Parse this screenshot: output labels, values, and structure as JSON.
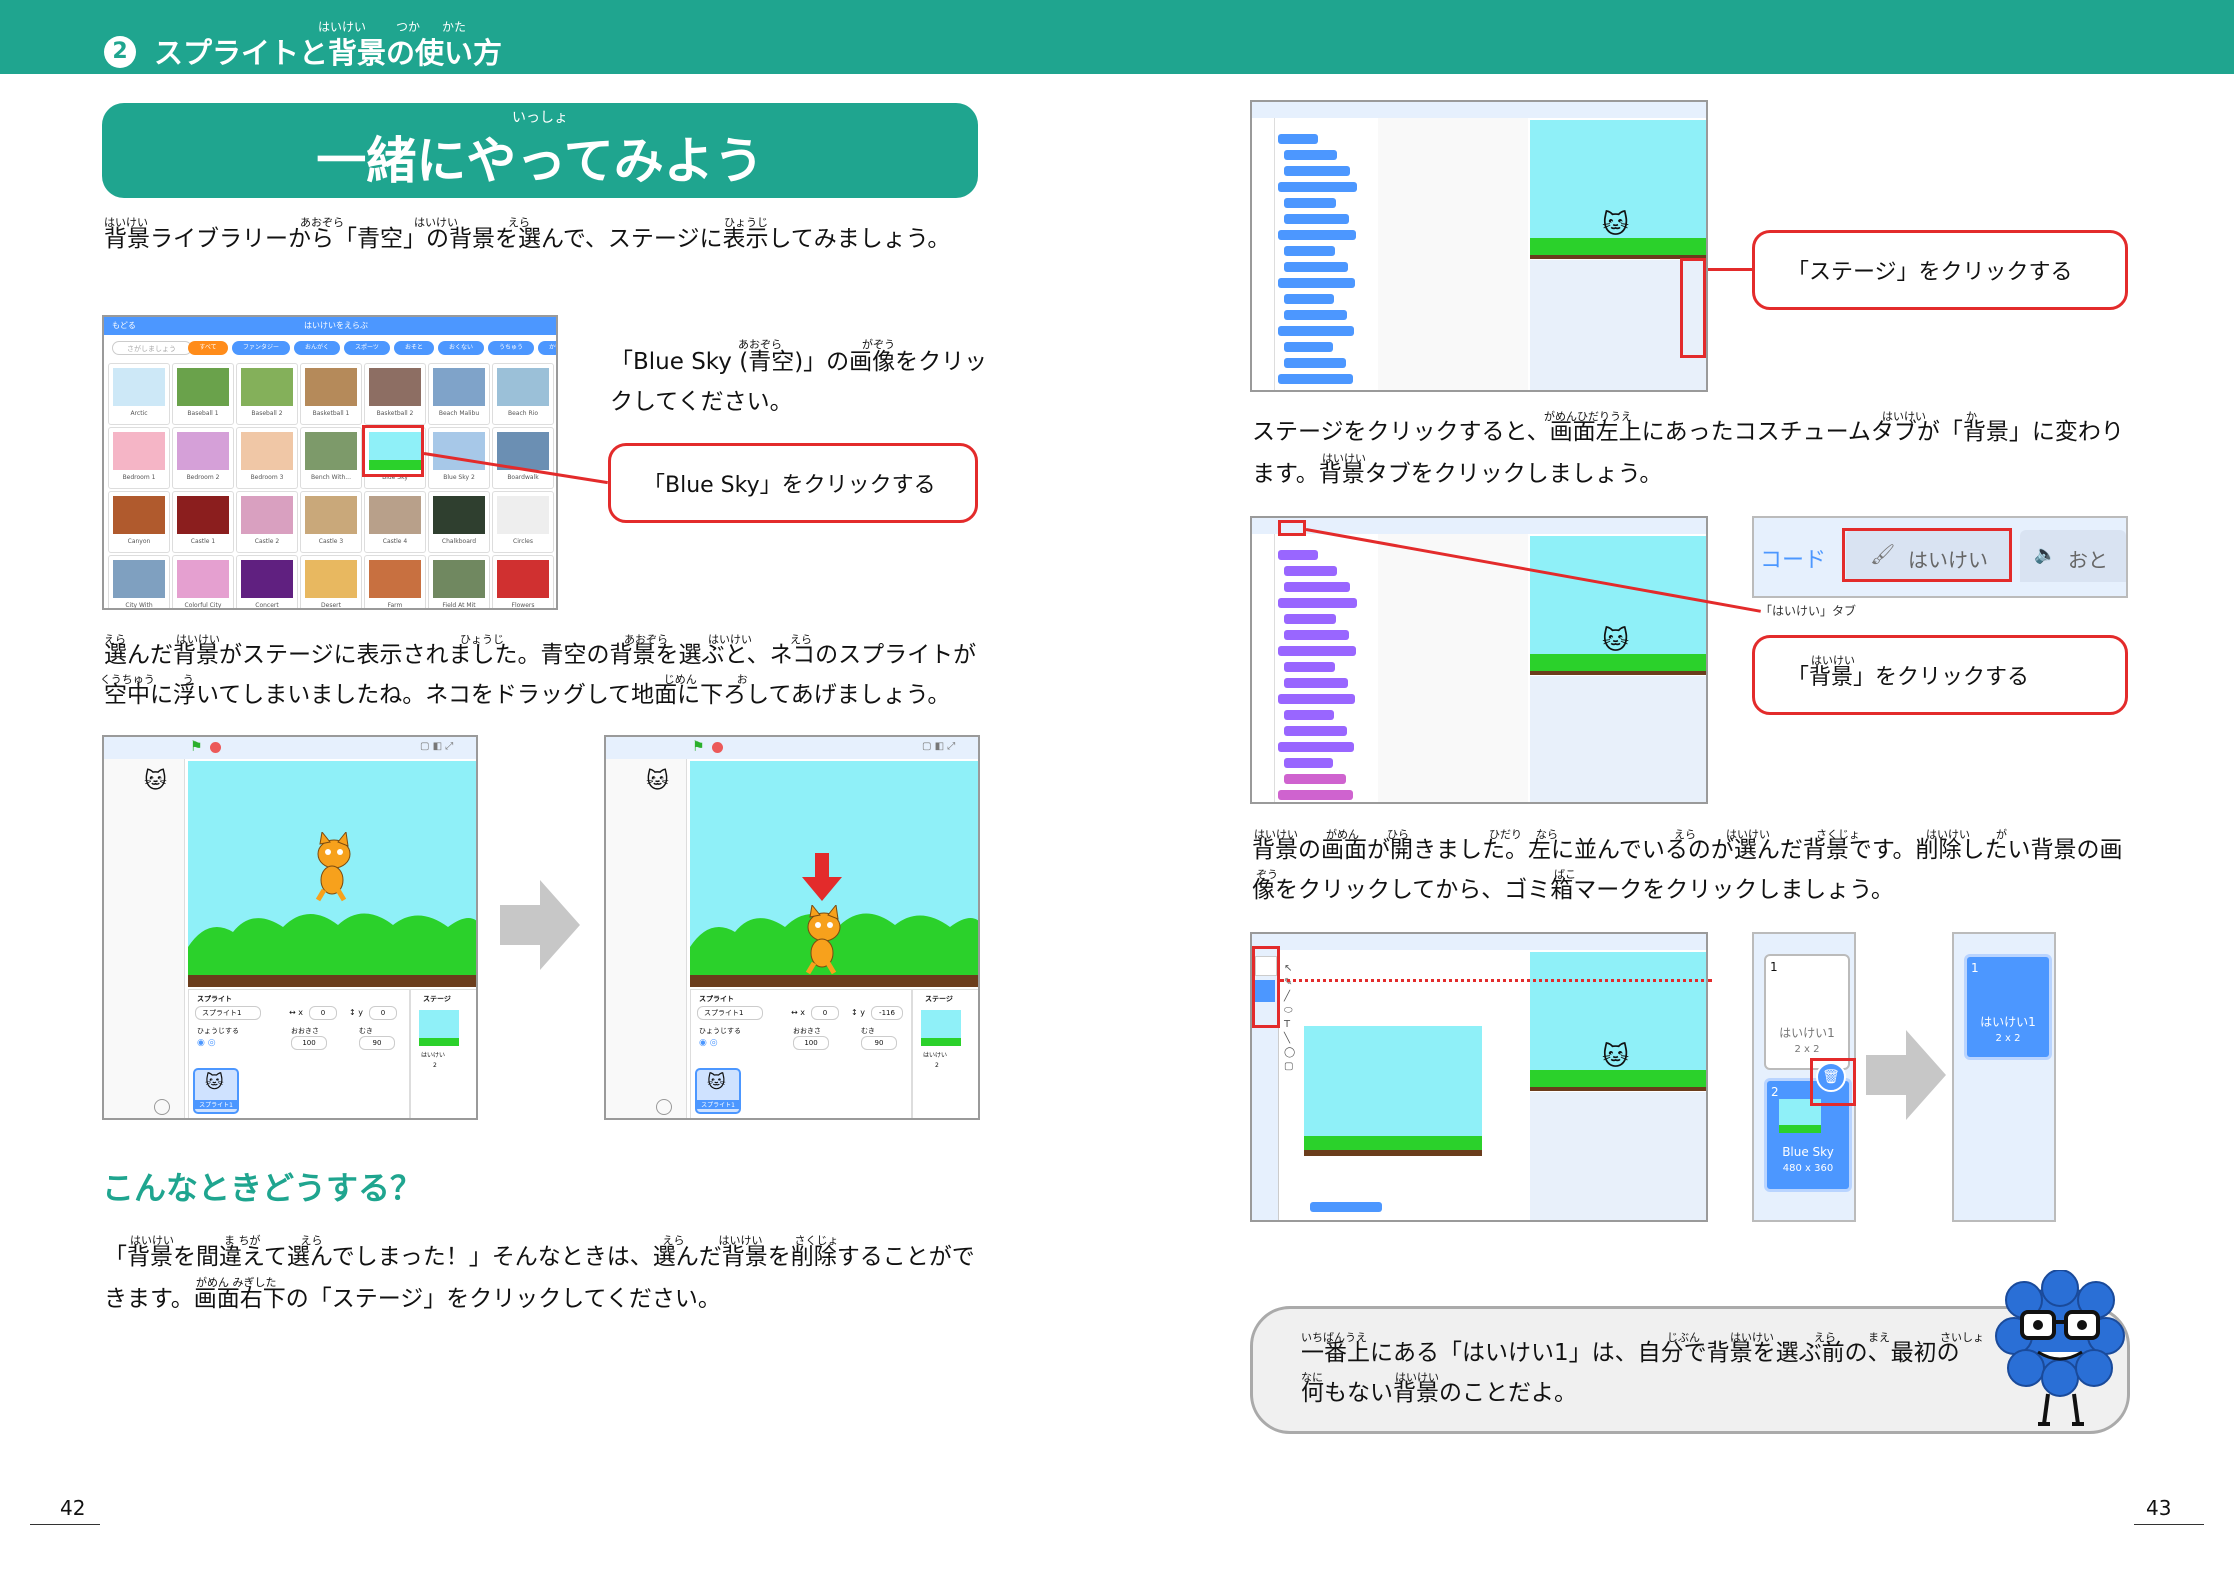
{
  "header": {
    "chapter_number": "2",
    "chapter_title": "スプライトと背景の使い方",
    "chapter_ruby": [
      "はいけい",
      "つか",
      "かた"
    ]
  },
  "left_page": {
    "title": "一緒にやってみよう",
    "title_ruby": "いっしょ",
    "intro": "背景ライブラリーから「青空」の背景を選んで、ステージに表示してみましょう。",
    "intro_ruby": [
      "はいけい",
      "あおぞら",
      "はいけい",
      "えら",
      "ひょうじ"
    ],
    "library_instruction_line1": "「Blue Sky (青空)」の画像をクリッ",
    "library_instruction_line2": "クしてください。",
    "library_instruction_ruby": [
      "あおぞら",
      "がぞう"
    ],
    "library_callout": "「Blue Sky」をクリックする",
    "library": {
      "header_back": "もどる",
      "header_title": "はいけいをえらぶ",
      "search_placeholder": "さがしましょう",
      "filters": [
        "すべて",
        "ファンタジー",
        "おんがく",
        "スポーツ",
        "おそと",
        "おくない",
        "うちゅう",
        "かいちゅう",
        "もよう"
      ],
      "items": [
        "Arctic",
        "Baseball 1",
        "Baseball 2",
        "Basketball 1",
        "Basketball 2",
        "Beach Malibu",
        "Beach Rio",
        "Bedroom 1",
        "Bedroom 2",
        "Bedroom 3",
        "Bench With...",
        "Blue Sky",
        "Blue Sky 2",
        "Boardwalk",
        "Canyon",
        "Castle 1",
        "Castle 2",
        "Castle 3",
        "Castle 4",
        "Chalkboard",
        "Circles",
        "City With",
        "Colorful City",
        "Concert",
        "Desert",
        "Farm",
        "Field At Mit",
        "Flowers"
      ]
    },
    "after_text_line1": "選んだ背景がステージに表示されました。青空の背景を選ぶと、ネコのスプライトが",
    "after_text_line2": "空中に浮いてしまいましたね。ネコをドラッグして地面に下ろしてあげましょう。",
    "after_ruby_line1": [
      "えら",
      "はいけい",
      "ひょうじ",
      "あおぞら",
      "はいけい",
      "えら"
    ],
    "after_ruby_line2": [
      "くうちゅう",
      "う",
      "じめん",
      "お"
    ],
    "editor": {
      "sprite_label": "スプライト",
      "sprite_name": "スプライト1",
      "show_label": "ひょうじする",
      "size_label": "おおきさ",
      "direction_label": "むき",
      "size_value": "100",
      "direction_value": "90",
      "x_value": "0",
      "y_before": "0",
      "y_after": "-116",
      "stage_label": "ステージ",
      "backdrop_label": "はいけい",
      "backdrop_count": "2",
      "sprite_thumb_label": "スプライト1"
    },
    "section_heading": "こんなときどうする？",
    "trouble_line1": "「背景を間違えて選んでしまった！」そんなときは、選んだ背景を削除することがで",
    "trouble_line2": "きます。画面右下の「ステージ」をクリックしてください。",
    "trouble_ruby_line1": [
      "はいけい",
      "ま ちが",
      "えら",
      "えら",
      "はいけい",
      "さくじょ"
    ],
    "trouble_ruby_line2": [
      "がめん みぎした"
    ],
    "page_number": "42"
  },
  "right_page": {
    "stage_callout": "「ステージ」をクリックする",
    "text1_line1": "ステージをクリックすると、画面左上にあったコスチュームタブが「背景」に変わり",
    "text1_line2": "ます。背景タブをクリックしましょう。",
    "text1_ruby_line1": [
      "がめんひだりうえ",
      "はいけい",
      "か"
    ],
    "text1_ruby_line2": [
      "はいけい"
    ],
    "tabs": {
      "code": "コード",
      "backdrops": "はいけい",
      "sounds": "おと"
    },
    "tab_caption": "「はいけい」タブ",
    "backdrop_callout": "「背景」をクリックする",
    "backdrop_callout_ruby": "はいけい",
    "text2_line1": "背景の画面が開きました。左に並んでいるのが選んだ背景です。削除したい背景の画",
    "text2_line2": "像をクリックしてから、ゴミ箱マークをクリックしましょう。",
    "text2_ruby_line1": [
      "はいけい",
      "がめん",
      "ひら",
      "ひだり",
      "なら",
      "えら",
      "はいけい",
      "さくじょ",
      "はいけい",
      "が"
    ],
    "text2_ruby_line2": [
      "ぞう",
      "ばこ"
    ],
    "backdrop_list": {
      "item1_number": "1",
      "item1_name": "はいけい1",
      "item1_size": "2 x 2",
      "item2_number": "2",
      "item2_name": "Blue Sky",
      "item2_size": "480 x 360"
    },
    "tip_line1": "一番上にある「はいけい1」は、自分で背景を選ぶ前の、最初の",
    "tip_line2": "何もない背景のことだよ。",
    "tip_ruby_line1": [
      "いちばんうえ",
      "じぶん",
      "はいけい",
      "えら",
      "まえ",
      "さいしょ"
    ],
    "tip_ruby_line2": [
      "なに",
      "はいけい"
    ],
    "page_number": "43"
  },
  "colors": {
    "brand_teal": "#1fa58f",
    "callout_red": "#e32b2b",
    "scratch_blue": "#4c97ff",
    "sky_blue": "#8ff0f8",
    "grass_green": "#2bd12b",
    "cat_orange": "#f7a11c"
  }
}
